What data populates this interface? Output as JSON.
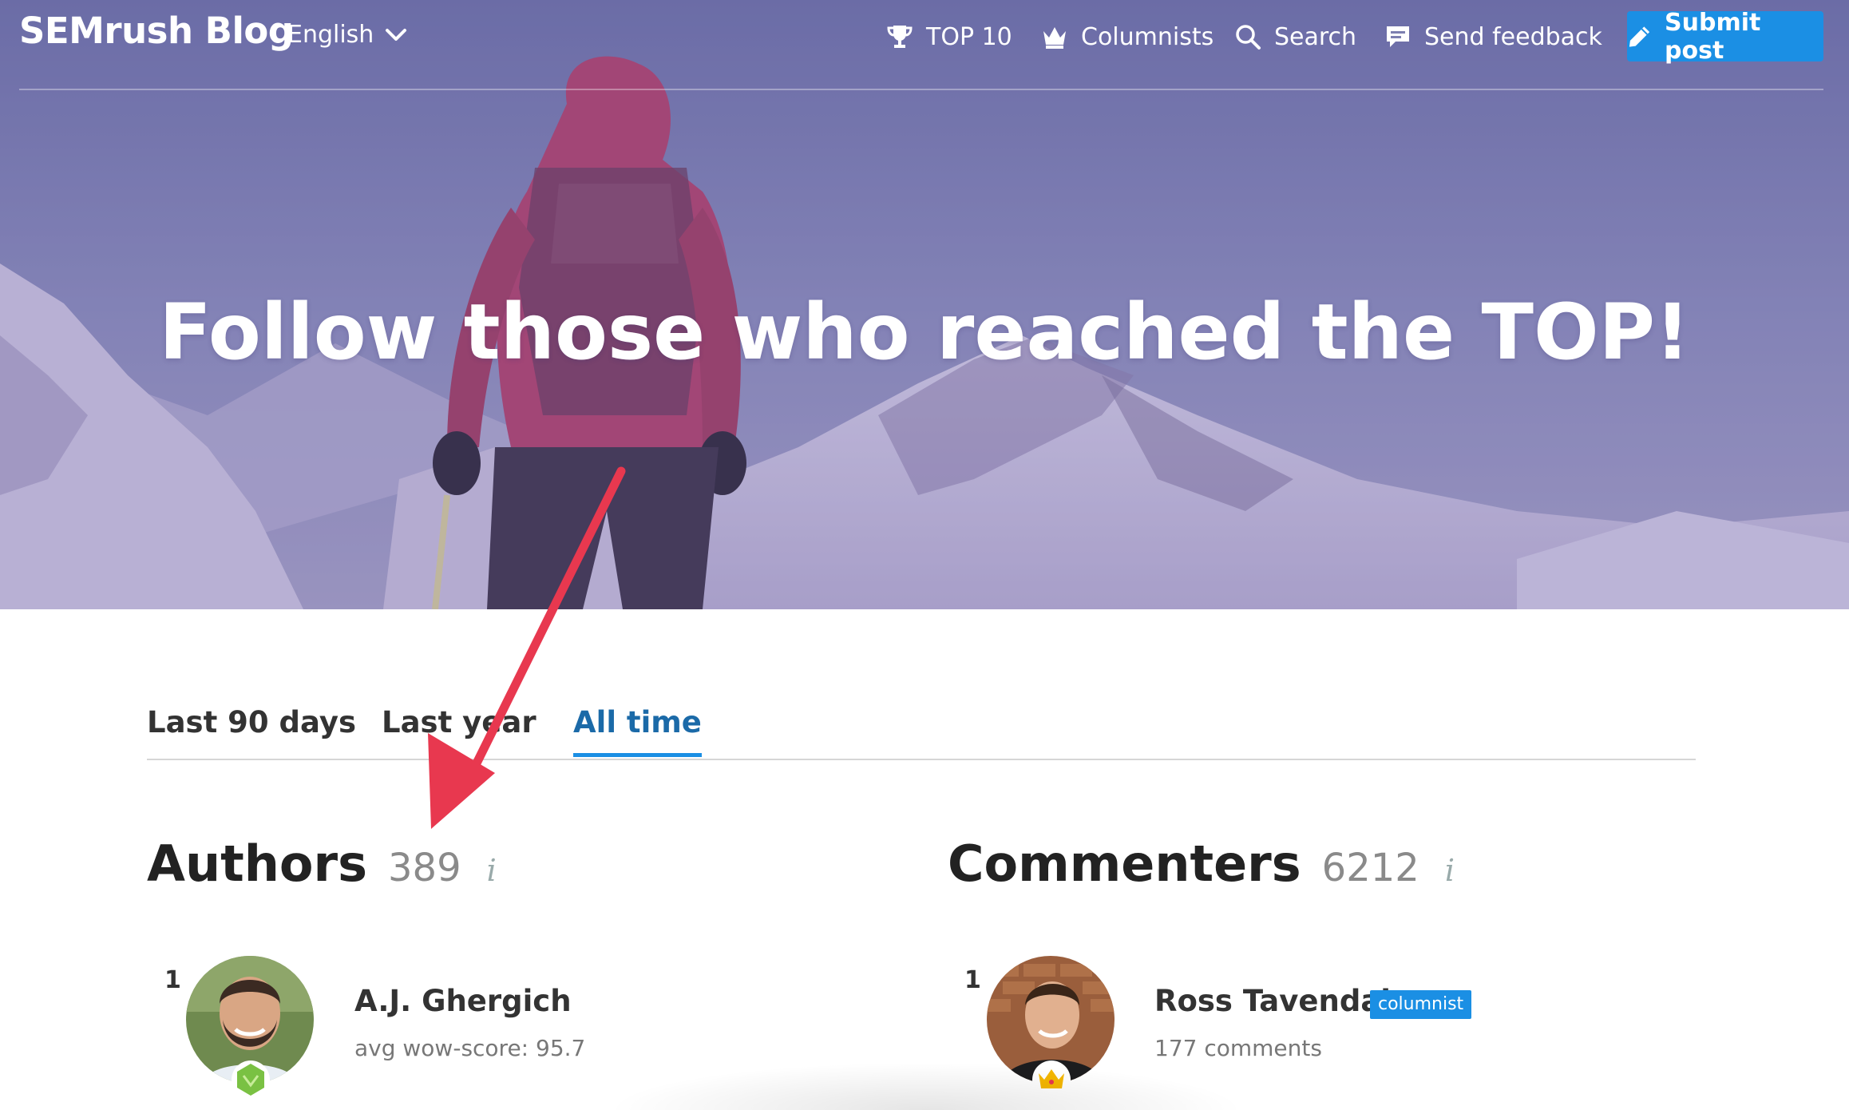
{
  "brand": {
    "logo": "SEMrush Blog",
    "language": "English"
  },
  "nav": {
    "top10": "TOP 10",
    "columnists": "Columnists",
    "search": "Search",
    "feedback": "Send feedback",
    "submit": "Submit post"
  },
  "hero": {
    "headline": "Follow those who reached the TOP!"
  },
  "tabs": [
    "Last 90 days",
    "Last year",
    "All time"
  ],
  "active_tab": "All time",
  "authors": {
    "title": "Authors",
    "count": "389",
    "info": "i",
    "rank": "1",
    "name": "A.J. Ghergich",
    "stat": "avg wow-score: 95.7"
  },
  "commenters": {
    "title": "Commenters",
    "count": "6212",
    "info": "i",
    "rank": "1",
    "name": "Ross Tavendale",
    "badge": "columnist",
    "stat": "177 comments"
  },
  "colors": {
    "accent": "#1b8fe4",
    "annotation_arrow": "#e8384f"
  }
}
